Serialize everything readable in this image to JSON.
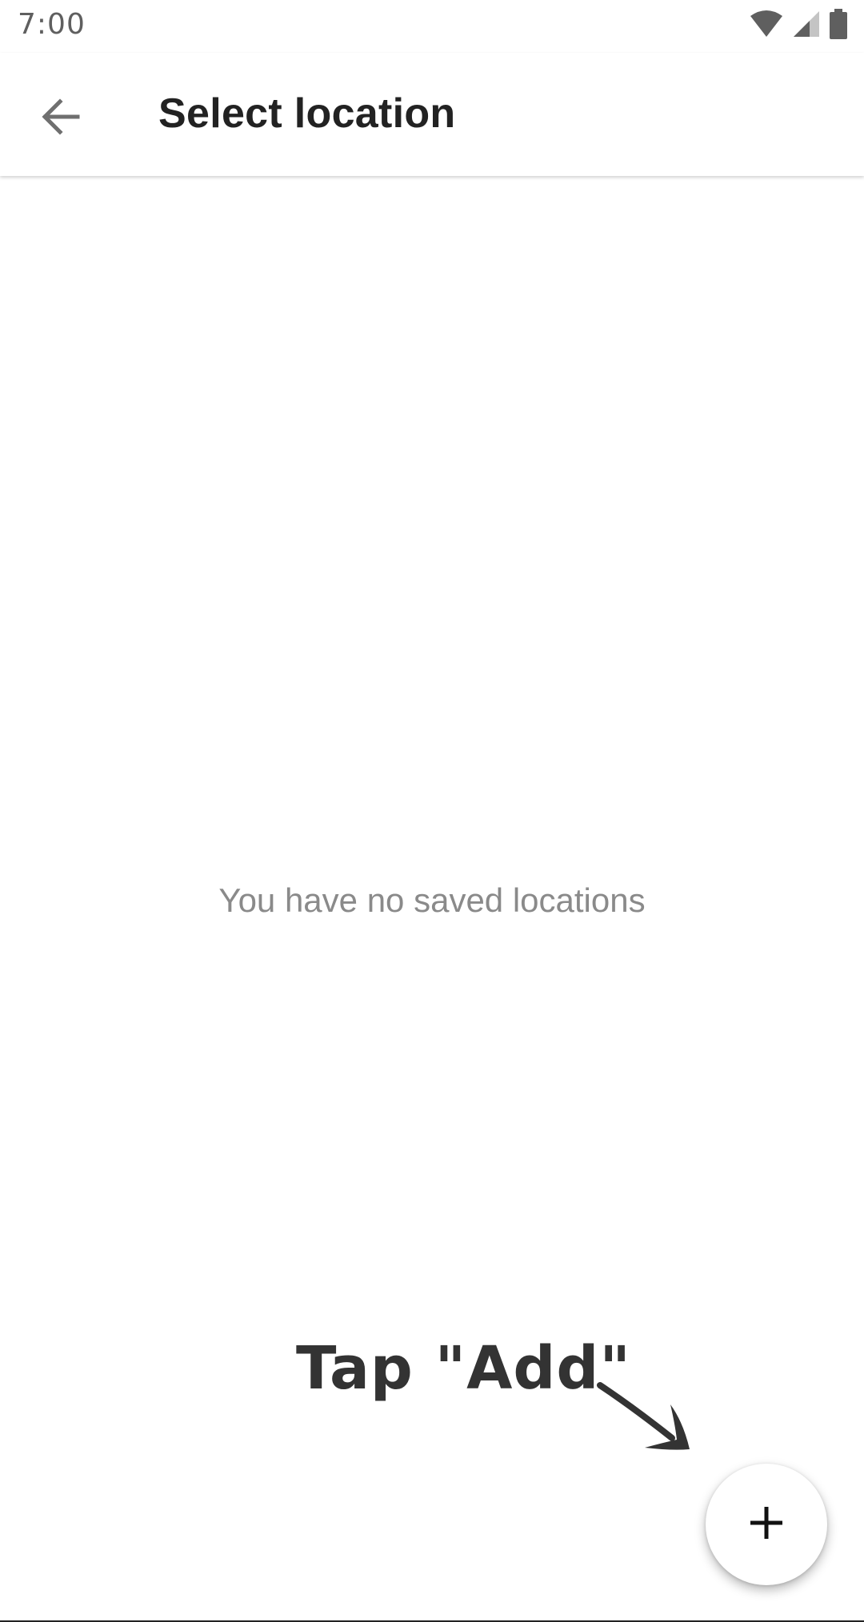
{
  "status_bar": {
    "time": "7:00",
    "icons": [
      "wifi-icon",
      "cell-signal-icon",
      "battery-icon"
    ]
  },
  "app_bar": {
    "back_icon": "arrow-back-icon",
    "title": "Select location"
  },
  "main": {
    "empty_message": "You have no saved locations"
  },
  "hint": {
    "text": "Tap \"Add\"",
    "arrow_icon": "hand-drawn-arrow-icon"
  },
  "fab": {
    "icon": "plus-icon"
  },
  "colors": {
    "title_text": "#222222",
    "secondary_text": "#8a8a8a",
    "icon_grey": "#6f6f6f",
    "background": "#ffffff"
  }
}
